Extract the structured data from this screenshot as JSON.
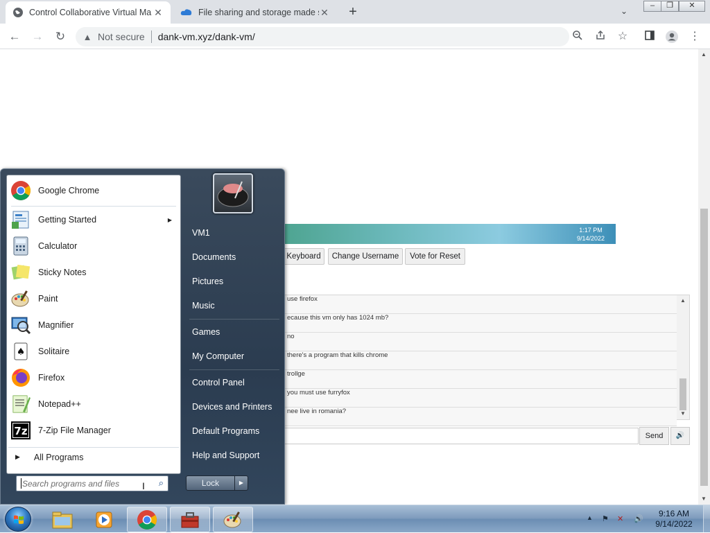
{
  "browser": {
    "tabs": [
      {
        "title": "Control Collaborative Virtual Ma",
        "active": true
      },
      {
        "title": "File sharing and storage made sim",
        "active": false
      }
    ],
    "address": {
      "security_label": "Not secure",
      "url": "dank-vm.xyz/dank-vm/"
    }
  },
  "vm": {
    "clock": {
      "time": "1:17 PM",
      "date": "9/14/2022"
    },
    "buttons": {
      "keyboard": "Keyboard",
      "change_username": "Change Username",
      "vote_reset": "Vote for Reset",
      "send": "Send"
    },
    "chat": [
      "use firefox",
      "ecause this vm only has 1024 mb?",
      "no",
      "there's a program that kills chrome",
      "trollge",
      "you must use furryfox",
      "nee live in romania?"
    ]
  },
  "start_menu": {
    "programs": [
      {
        "label": "Google Chrome",
        "icon": "chrome-icon"
      },
      {
        "label": "Getting Started",
        "icon": "getting-started-icon",
        "has_submenu": true
      },
      {
        "label": "Calculator",
        "icon": "calculator-icon"
      },
      {
        "label": "Sticky Notes",
        "icon": "sticky-notes-icon"
      },
      {
        "label": "Paint",
        "icon": "paint-icon"
      },
      {
        "label": "Magnifier",
        "icon": "magnifier-icon"
      },
      {
        "label": "Solitaire",
        "icon": "solitaire-icon"
      },
      {
        "label": "Firefox",
        "icon": "firefox-icon"
      },
      {
        "label": "Notepad++",
        "icon": "notepadpp-icon"
      },
      {
        "label": "7-Zip File Manager",
        "icon": "7zip-icon"
      }
    ],
    "all_programs": "All Programs",
    "search_placeholder": "Search programs and files",
    "right_links": [
      "VM1",
      "Documents",
      "Pictures",
      "Music",
      "Games",
      "My Computer",
      "Control Panel",
      "Devices and Printers",
      "Default Programs",
      "Help and Support"
    ],
    "lock": "Lock"
  },
  "taskbar": {
    "clock": {
      "time": "9:16 AM",
      "date": "9/14/2022"
    },
    "pinned": [
      "explorer-icon",
      "media-player-icon",
      "chrome-icon",
      "toolbox-icon",
      "paint-icon"
    ]
  }
}
